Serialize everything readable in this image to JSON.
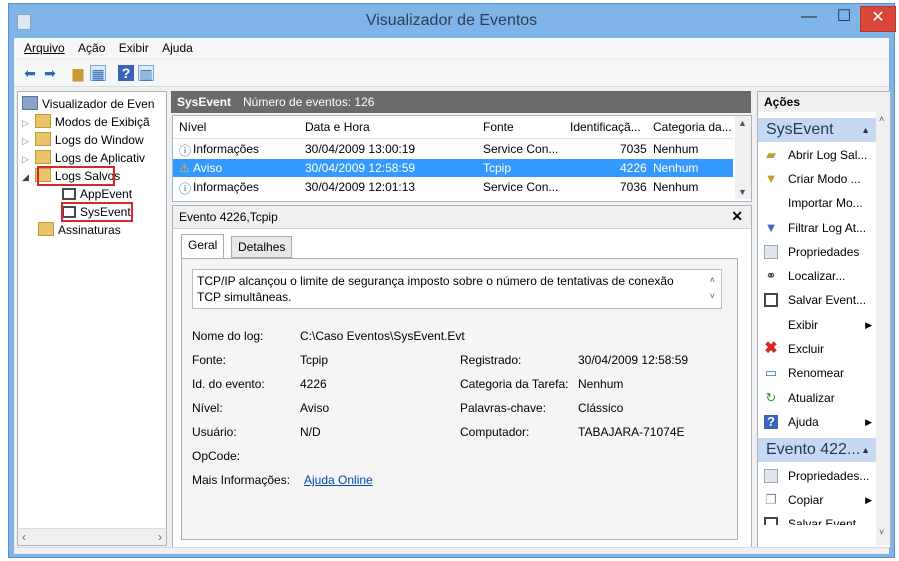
{
  "window": {
    "title": "Visualizador de Eventos",
    "min": "—",
    "max": "☐",
    "close": "✕"
  },
  "menu": [
    "Arquivo",
    "Ação",
    "Exibir",
    "Ajuda"
  ],
  "tree": {
    "root": "Visualizador de Even",
    "items": [
      "Modos de Exibiçã",
      "Logs do Window",
      "Logs de Aplicativ",
      "Logs Salvos",
      "AppEvent",
      "SysEvent",
      "Assinaturas"
    ]
  },
  "pane_header": {
    "name": "SysEvent",
    "count": "Número de eventos: 126"
  },
  "table": {
    "columns": [
      "Nível",
      "Data e Hora",
      "Fonte",
      "Identificaçã...",
      "Categoria da..."
    ],
    "rows": [
      {
        "level": "Informações",
        "date": "30/04/2009 13:00:19",
        "source": "Service Con...",
        "id": "7035",
        "category": "Nenhum"
      },
      {
        "level": "Aviso",
        "date": "30/04/2009 12:58:59",
        "source": "Tcpip",
        "id": "4226",
        "category": "Nenhum"
      },
      {
        "level": "Informações",
        "date": "30/04/2009 12:01:13",
        "source": "Service Con...",
        "id": "7036",
        "category": "Nenhum"
      }
    ]
  },
  "detail": {
    "title": "Evento 4226,Tcpip",
    "tabs": [
      "Geral",
      "Detalhes"
    ],
    "description": "TCP/IP alcançou o limite de segurança imposto sobre o número de tentativas de conexão TCP simultâneas.",
    "log_name_label": "Nome do log:",
    "log_name": "C:\\Caso Eventos\\SysEvent.Evt",
    "source_label": "Fonte:",
    "source": "Tcpip",
    "recorded_label": "Registrado:",
    "recorded": "30/04/2009 12:58:59",
    "event_id_label": "Id. do evento:",
    "event_id": "4226",
    "task_label": "Categoria da Tarefa:",
    "task": "Nenhum",
    "level_label": "Nível:",
    "level": "Aviso",
    "keywords_label": "Palavras-chave:",
    "keywords": "Clássico",
    "user_label": "Usuário:",
    "user": "N/D",
    "computer_label": "Computador:",
    "computer": "TABAJARA-71074E",
    "opcode_label": "OpCode:",
    "more_label": "Mais Informações:",
    "more_link": "Ajuda Online"
  },
  "actions": {
    "header": "Ações",
    "section1": "SysEvent",
    "items1": [
      "Abrir Log Sal...",
      "Criar Modo ...",
      "Importar Mo...",
      "Filtrar Log At...",
      "Propriedades",
      "Localizar...",
      "Salvar Event...",
      "Exibir",
      "Excluir",
      "Renomear",
      "Atualizar",
      "Ajuda"
    ],
    "section2": "Evento 422...",
    "items2": [
      "Propriedades...",
      "Copiar",
      "Salvar Event..."
    ]
  }
}
